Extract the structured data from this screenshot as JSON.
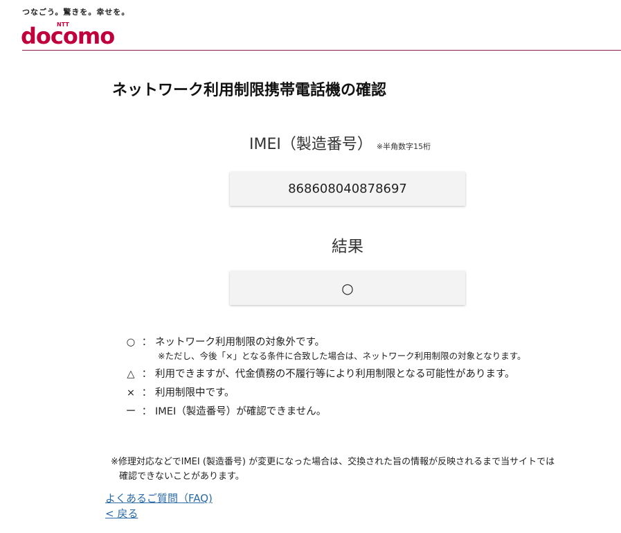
{
  "header": {
    "tagline": "つなごう。驚きを。幸せを。",
    "logo_small": "NTT",
    "logo_text": "docomo",
    "brand_color": "#c0003c"
  },
  "page_title": "ネットワーク利用制限携帯電話機の確認",
  "imei": {
    "label": "IMEI（製造番号）",
    "note": "※半角数字15桁",
    "value": "868608040878697"
  },
  "result": {
    "label": "結果",
    "value": "○"
  },
  "legend": [
    {
      "symbol": "○",
      "colon": "：",
      "text": "ネットワーク利用制限の対象外です。"
    },
    {
      "symbol": "△",
      "colon": "：",
      "text": "利用できますが、代金債務の不履行等により利用制限となる可能性があります。"
    },
    {
      "symbol": "×",
      "colon": "：",
      "text": "利用制限中です。"
    },
    {
      "symbol": "ー",
      "colon": "：",
      "text": "IMEI（製造番号）が確認できません。"
    }
  ],
  "legend_sub": "※ただし、今後「×」となる条件に合致した場合は、ネットワーク利用制限の対象となります。",
  "footnote": {
    "line1": "※修理対応などでIMEI (製造番号) が変更になった場合は、交換された旨の情報が反映されるまで当サイトでは",
    "line2": "確認できないことがあります。"
  },
  "links": {
    "faq": "よくあるご質問（FAQ)",
    "back": "< 戻る"
  }
}
